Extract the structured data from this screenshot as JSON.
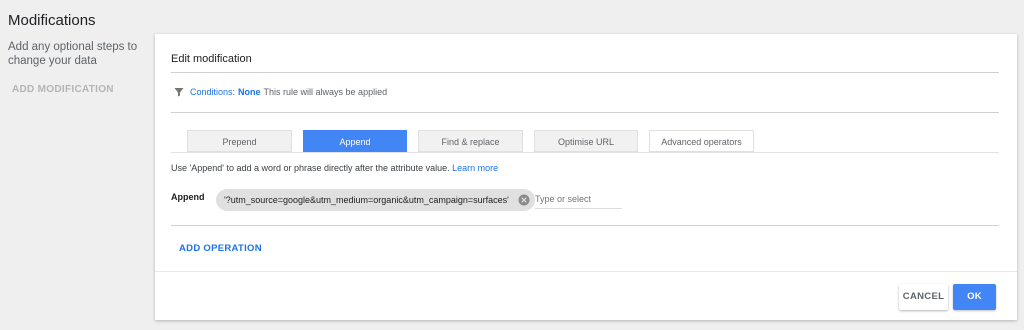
{
  "left": {
    "title": "Modifications",
    "description": "Add any optional steps to change your data",
    "add_modification_label": "ADD MODIFICATION"
  },
  "card": {
    "header": "Edit modification",
    "conditions": {
      "icon": "filter-icon",
      "label": "Conditions:",
      "value": "None",
      "text": "This rule will always be applied"
    },
    "tabs": [
      {
        "label": "Prepend",
        "active": false
      },
      {
        "label": "Append",
        "active": true
      },
      {
        "label": "Find & replace",
        "active": false
      },
      {
        "label": "Optimise URL",
        "active": false
      },
      {
        "label": "Advanced operators",
        "active": false
      }
    ],
    "help": {
      "text": "Use 'Append' to add a word or phrase directly after the attribute value.",
      "link": "Learn more"
    },
    "append": {
      "label": "Append",
      "chip": "'?utm_source=google&utm_medium=organic&utm_campaign=surfaces'",
      "chip_icon": "close-circle-icon",
      "input_placeholder": "Type or select",
      "input_value": ""
    },
    "add_operation_label": "ADD OPERATION",
    "buttons": {
      "cancel": "CANCEL",
      "ok": "OK"
    }
  },
  "colors": {
    "accent": "#4285f4",
    "link": "#1a73e8",
    "background": "#efefef"
  }
}
